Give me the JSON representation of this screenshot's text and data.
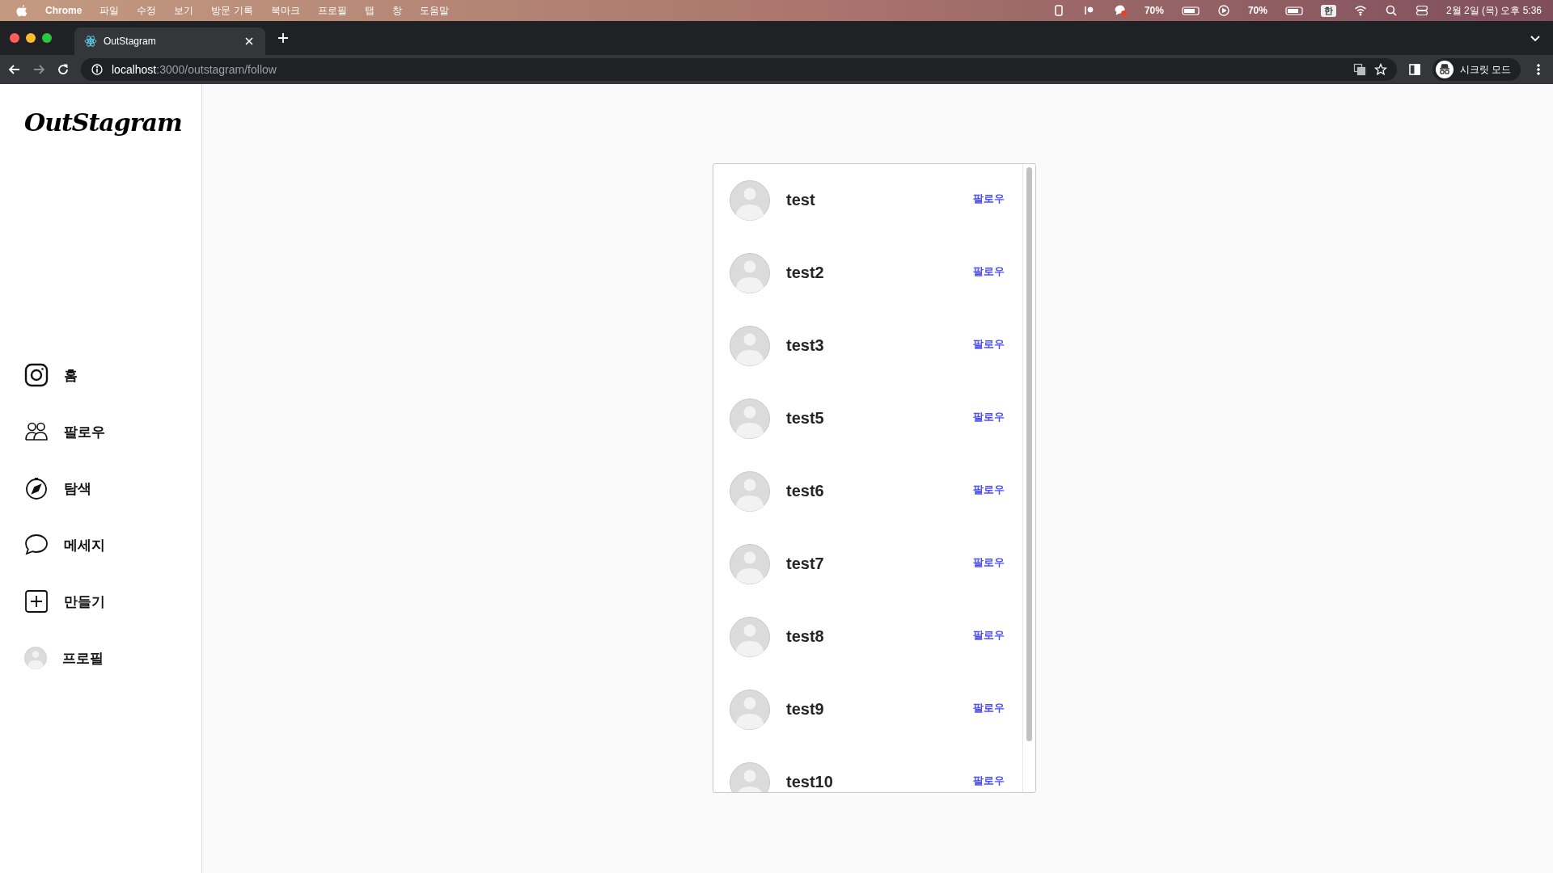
{
  "menu_bar": {
    "app": "Chrome",
    "items": [
      "파일",
      "수정",
      "보기",
      "방문 기록",
      "북마크",
      "프로필",
      "탭",
      "창",
      "도움말"
    ],
    "battery_1": "70%",
    "battery_2": "70%",
    "input_method": "한",
    "clock": "2월 2일 (목) 오후 5:36"
  },
  "browser": {
    "tab": {
      "title": "OutStagram",
      "selected": true
    },
    "url_host": "localhost",
    "url_path": ":3000/outstagram/follow",
    "profile": "시크릿 모드"
  },
  "sidebar": {
    "logo": "OutStagram",
    "items": [
      {
        "kind": "home",
        "label": "홈"
      },
      {
        "kind": "follow",
        "label": "팔로우"
      },
      {
        "kind": "explore",
        "label": "탐색"
      },
      {
        "kind": "message",
        "label": "메세지"
      },
      {
        "kind": "create",
        "label": "만들기"
      },
      {
        "kind": "profile",
        "label": "프로필"
      }
    ]
  },
  "users": [
    {
      "name": "test",
      "action": "팔로우"
    },
    {
      "name": "test2",
      "action": "팔로우"
    },
    {
      "name": "test3",
      "action": "팔로우"
    },
    {
      "name": "test5",
      "action": "팔로우"
    },
    {
      "name": "test6",
      "action": "팔로우"
    },
    {
      "name": "test7",
      "action": "팔로우"
    },
    {
      "name": "test8",
      "action": "팔로우"
    },
    {
      "name": "test9",
      "action": "팔로우"
    },
    {
      "name": "test10",
      "action": "팔로우"
    }
  ]
}
